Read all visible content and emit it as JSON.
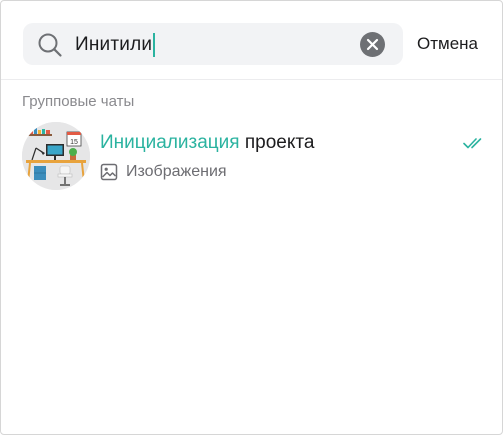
{
  "search": {
    "query": "Инитили",
    "cancel_label": "Отмена"
  },
  "section": {
    "title": "Групповые чаты"
  },
  "results": [
    {
      "title_match": "Инициализация",
      "title_rest": " проекта",
      "subtitle": "Изображения",
      "subtitle_icon": "image-icon",
      "status_icon": "double-check-icon",
      "avatar_calendar_day": "15"
    }
  ],
  "colors": {
    "accent": "#2bb3a0",
    "search_bg": "#f2f3f5",
    "clear_button": "#6e7074",
    "muted_text": "#8a8a8e"
  }
}
